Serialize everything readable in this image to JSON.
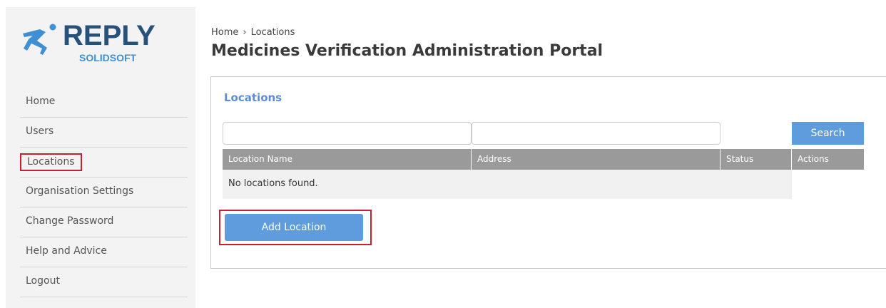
{
  "logo": {
    "wordmark": "REPLY",
    "subtitle": "SOLIDSOFT",
    "icon": "runner-icon",
    "colors": {
      "wordmark": "#25517a",
      "subtitle": "#3f8fd4"
    }
  },
  "sidebar": {
    "items": [
      {
        "label": "Home"
      },
      {
        "label": "Users"
      },
      {
        "label": "Locations",
        "active": true
      },
      {
        "label": "Organisation Settings"
      },
      {
        "label": "Change Password"
      },
      {
        "label": "Help and Advice"
      },
      {
        "label": "Logout"
      }
    ]
  },
  "breadcrumb": {
    "home": "Home",
    "separator": "›",
    "current": "Locations"
  },
  "page_title": "Medicines Verification Administration Portal",
  "panel": {
    "title": "Locations",
    "filters": {
      "name_value": "",
      "address_value": ""
    },
    "search_label": "Search",
    "columns": [
      "Location Name",
      "Address",
      "Status",
      "Actions"
    ],
    "empty_message": "No locations found.",
    "add_label": "Add Location"
  },
  "colors": {
    "accent": "#5e9cdd",
    "header_grey": "#9a9a9a",
    "highlight_red": "#c8202e",
    "panel_title": "#5b8fd4"
  }
}
